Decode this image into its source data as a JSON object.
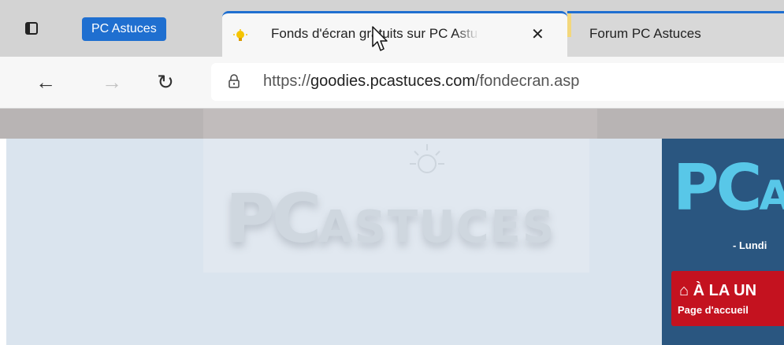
{
  "browser": {
    "group_label": "PC Astuces",
    "tabs": [
      {
        "title": "Fonds d'écran gratuits sur PC Astuces",
        "close": "✕",
        "active": true
      },
      {
        "title": "Forum PC Astuces",
        "active": false
      }
    ],
    "nav": {
      "back": "←",
      "forward": "→",
      "refresh": "↻"
    },
    "url": {
      "scheme": "https://",
      "host": "goodies.pcastuces.com",
      "path": "/fondecran.asp"
    }
  },
  "page": {
    "watermark_big": "PC",
    "watermark_small": "ASTUCES",
    "logo_main": "PC",
    "logo_tail": "A",
    "date_text": "- Lundi",
    "news_label": "À LA UN",
    "home_label": "Page d'accueil"
  },
  "colors": {
    "accent": "#1f6fd0",
    "site_blue": "#2a5680",
    "site_red": "#c4121f",
    "logo_cyan": "#58c7e8"
  }
}
